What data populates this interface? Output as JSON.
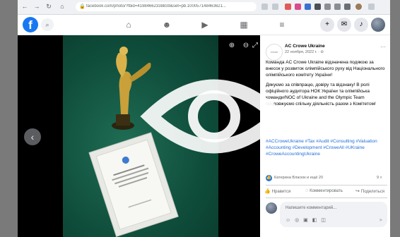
{
  "browser": {
    "url": "facebook.com/photo/?fbid=41984662338839&set=pb.100057148463621...",
    "nav": {
      "back": "←",
      "forward": "→",
      "reload": "↻",
      "home": "⌂"
    }
  },
  "fb_header": {
    "logo": "f",
    "nav_icons": [
      "home-icon",
      "friends-icon",
      "watch-icon",
      "marketplace-icon",
      "menu-icon"
    ],
    "right_icons": [
      "plus-icon",
      "messenger-icon",
      "bell-icon"
    ]
  },
  "viewer": {
    "prev": "‹",
    "controls": [
      "⊕",
      "⊖",
      "⤢"
    ],
    "certificate_text": "Висловлюємо подяку\nACC Crowe Ukraine\nза внесок у розвиток\nолімпійського руху"
  },
  "post": {
    "avatar_text": "crowe",
    "author": "AC Crowe Ukraine",
    "date": "22 ноября, 2022 г. · ⊘",
    "more": "···",
    "text": [
      "Команда AC Crowe Ukraine відзначена подякою за внесок у розвиток олімпійського руху від Національного олімпійського комітету України!",
      "Дякуємо за співпрацю, довіру та відзнаку! В ролі офіційного аудитора НОК України та олімпійська команди/NOC of Ukraine and the Olympic Team продовжуємо спільну діяльність разом з Комітетом!"
    ],
    "tags": "#ACCroweUkraine #Tax #Audit #Consulting #Valuation #Accounting #Development #CroweAll #UKraine #CroweAccountingUkraine",
    "reactions": "Катерина Власюк и ещё 20",
    "comments_count": "9 ⌕",
    "actions": {
      "like": "Нравится",
      "comment": "Комментировать",
      "share": "Поделиться"
    },
    "comment_placeholder": "Напишите комментарий...",
    "comment_icons": "☺ ◎ ▣ ◧ ◫",
    "send": "➤"
  }
}
